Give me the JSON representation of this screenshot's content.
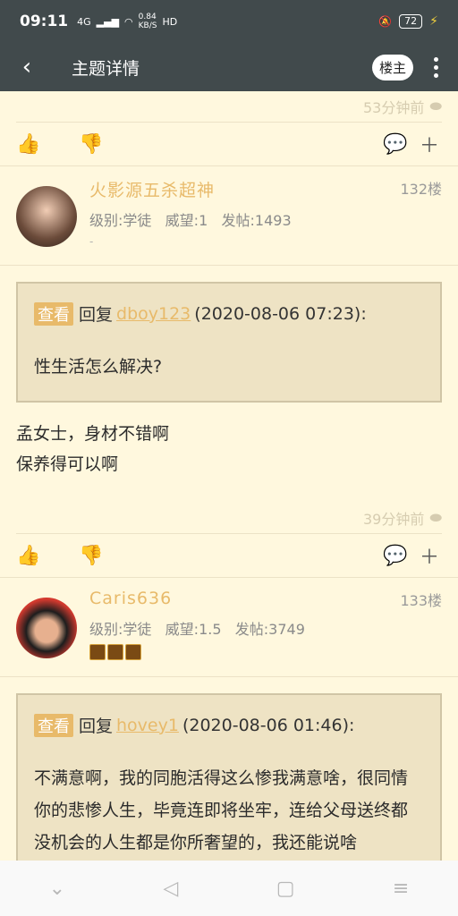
{
  "status": {
    "time": "09:11",
    "net": "4G",
    "speed_num": "0.84",
    "speed_unit": "KB/S",
    "hd": "HD",
    "battery": "72"
  },
  "appbar": {
    "title": "主题详情",
    "owner_button": "楼主"
  },
  "posts": [
    {
      "time": "53分钟前"
    },
    {
      "username": "火影源五杀超神",
      "floor": "132楼",
      "level": "级别:学徒",
      "prestige": "威望:1",
      "posts": "发帖:1493",
      "extra": "-",
      "quote": {
        "tag": "查看",
        "reply": "回复",
        "user": "dboy123",
        "date": "(2020-08-06 07:23):",
        "text": "性生活怎么解决?"
      },
      "body": [
        "孟女士，身材不错啊",
        "保养得可以啊"
      ],
      "time": "39分钟前"
    },
    {
      "username": "Caris636",
      "floor": "133楼",
      "level": "级别:学徒",
      "prestige": "威望:1.5",
      "posts": "发帖:3749",
      "quote": {
        "tag": "查看",
        "reply": "回复",
        "user": "hovey1",
        "date": "(2020-08-06 01:46):",
        "text": "不满意啊，我的同胞活得这么惨我满意啥，很同情你的悲惨人生，毕竟连即将坐牢，连给父母送终都没机会的人生都是你所奢望的，我还能说啥"
      }
    }
  ],
  "colors": {
    "appbar": "#414a4c",
    "background": "#fff8de",
    "accent": "#e8ba6a"
  },
  "icons": [
    "back-icon",
    "more-icon",
    "thumb-up-icon",
    "thumb-down-icon",
    "comment-icon",
    "add-icon",
    "android-icon"
  ]
}
